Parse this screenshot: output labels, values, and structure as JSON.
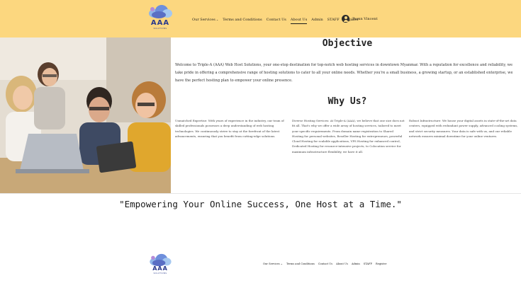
{
  "header": {
    "background": "#fcd77f",
    "logo": {
      "text": "AAA",
      "subtext": "SOLUTIONS",
      "icon": "cloud-logo-icon"
    },
    "nav": [
      {
        "label": "Our Services",
        "has_dropdown": true
      },
      {
        "label": "Terms and Conditions"
      },
      {
        "label": "Contact Us"
      },
      {
        "label": "About Us",
        "active": true
      },
      {
        "label": "Admin"
      },
      {
        "label": "STAFF"
      },
      {
        "label": "Register"
      }
    ],
    "user": {
      "name": "Jhonn Vincent",
      "icon": "user-avatar-icon"
    }
  },
  "hero": {
    "image": "students-with-laptop-and-tablet-photo"
  },
  "objective": {
    "title": "Objective",
    "text": "Welcome to Triple-A (AAA) Web Host Solutions, your one-stop destination for top-notch web hosting services in downtown Myanmar. With a reputation for excellence and reliability, we take pride in offering a comprehensive range of hosting solutions to cater to all your online needs. Whether you're a small business, a growing startup, or an established enterprise, we have the perfect hosting plan to empower your online presence."
  },
  "why_us": {
    "title": "Why Us?",
    "columns": [
      "Unmatched Expertise: With years of experience in the industry, our team of skilled professionals possesses a deep understanding of web hosting technologies. We continuously strive to stay at the forefront of the latest advancements, ensuring that you benefit from cutting-edge solutions.",
      "Diverse Hosting Services: At Triple-A (AAA), we believe that one size does not fit all. That's why we offer a wide array of hosting services, tailored to meet your specific requirements. From domain name registration to Shared Hosting for personal websites, Reseller Hosting for entrepreneurs, powerful Cloud Hosting for scalable applications, VPS Hosting for enhanced control, Dedicated Hosting for resource-intensive projects, to Colocation service for maximum infrastructure flexibility, we have it all.",
      "Robust Infrastructure: We house your digital assets in state-of-the-art data centers, equipped with redundant power supply, advanced cooling systems, and strict security measures. Your data is safe with us, and our reliable network ensures minimal downtime for your online ventures."
    ]
  },
  "quote": "\"Empowering Your Online Success, One Host at a Time.\"",
  "footer": {
    "logo": {
      "text": "AAA",
      "subtext": "SOLUTIONS"
    },
    "nav": [
      {
        "label": "Our Services",
        "has_dropdown": true
      },
      {
        "label": "Terms and Conditions"
      },
      {
        "label": "Contact Us"
      },
      {
        "label": "About Us"
      },
      {
        "label": "Admin"
      },
      {
        "label": "STAFF"
      },
      {
        "label": "Register"
      }
    ]
  }
}
